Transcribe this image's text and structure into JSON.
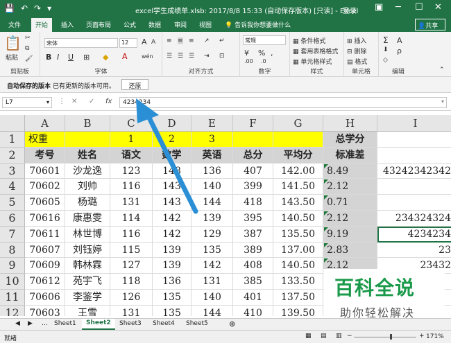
{
  "titlebar": {
    "title": "excel学生成绩单.xlsb: 2017/8/8 15:33 (自动保存版本) [只读] - Excel",
    "login": "登录",
    "save_icon": "save-icon",
    "undo_icon": "undo-icon",
    "redo_icon": "redo-icon"
  },
  "tabs": [
    "文件",
    "开始",
    "插入",
    "页面布局",
    "公式",
    "数据",
    "审阅",
    "视图"
  ],
  "active_tab": "开始",
  "tellme": "告诉我你想要做什么",
  "share": "共享",
  "ribbon": {
    "clipboard": {
      "paste": "粘贴",
      "label": "剪贴板"
    },
    "font": {
      "name": "宋体",
      "size": "12",
      "bold": "B",
      "italic": "I",
      "underline": "U",
      "grow": "A",
      "shrink": "A",
      "wen": "wén",
      "label": "字体"
    },
    "align": {
      "label": "对齐方式"
    },
    "number": {
      "format": "常规",
      "currency": "¥",
      "percent": "%",
      "comma": ",",
      "label": "数字"
    },
    "styles": {
      "cond": "条件格式",
      "table": "套用表格格式",
      "cell": "单元格样式",
      "label": "样式"
    },
    "cells": {
      "insert": "插入",
      "delete": "删除",
      "format": "格式",
      "label": "单元格"
    },
    "editing": {
      "sum": "Σ",
      "sort": "A",
      "find": "ρ",
      "label": "编辑"
    }
  },
  "msgbar": {
    "title": "自动保存的版本",
    "desc": "已有更新的版本可用。",
    "restore": "还原"
  },
  "formula": {
    "namebox": "L7",
    "cancel": "✕",
    "enter": "✓",
    "fx": "fx",
    "value": "4234234"
  },
  "grid": {
    "columns": [
      "A",
      "B",
      "C",
      "D",
      "E",
      "F",
      "G",
      "H",
      "I"
    ],
    "rows": [
      "1",
      "2",
      "3",
      "4",
      "5",
      "6",
      "7",
      "8",
      "9",
      "10",
      "11",
      "12",
      "13"
    ],
    "row1": {
      "a": "权重",
      "c": "1",
      "d": "2",
      "e": "3",
      "h": "总学分"
    },
    "headers": [
      "考号",
      "姓名",
      "语文",
      "数学",
      "英语",
      "总分",
      "平均分",
      "标准差"
    ],
    "data": [
      {
        "id": "70601",
        "name": "沙龙逸",
        "chinese": "123",
        "math": "148",
        "english": "136",
        "total": "407",
        "avg": "142.00",
        "std": "8.49",
        "extra": "43242342342"
      },
      {
        "id": "70602",
        "name": "刘帅",
        "chinese": "116",
        "math": "143",
        "english": "140",
        "total": "399",
        "avg": "141.50",
        "std": "2.12",
        "extra": ""
      },
      {
        "id": "70605",
        "name": "杨璐",
        "chinese": "131",
        "math": "143",
        "english": "144",
        "total": "418",
        "avg": "143.50",
        "std": "0.71",
        "extra": ""
      },
      {
        "id": "70616",
        "name": "康惠雯",
        "chinese": "114",
        "math": "142",
        "english": "139",
        "total": "395",
        "avg": "140.50",
        "std": "2.12",
        "extra": "234324324"
      },
      {
        "id": "70611",
        "name": "林世博",
        "chinese": "116",
        "math": "142",
        "english": "129",
        "total": "387",
        "avg": "135.50",
        "std": "9.19",
        "extra": "4234234"
      },
      {
        "id": "70607",
        "name": "刘钰婷",
        "chinese": "115",
        "math": "139",
        "english": "135",
        "total": "389",
        "avg": "137.00",
        "std": "2.83",
        "extra": "23"
      },
      {
        "id": "70609",
        "name": "韩林霖",
        "chinese": "127",
        "math": "139",
        "english": "142",
        "total": "408",
        "avg": "140.50",
        "std": "2.12",
        "extra": "23432"
      },
      {
        "id": "70612",
        "name": "苑宇飞",
        "chinese": "118",
        "math": "136",
        "english": "131",
        "total": "385",
        "avg": "133.50",
        "std": "",
        "extra": ""
      },
      {
        "id": "70606",
        "name": "李鉴学",
        "chinese": "126",
        "math": "135",
        "english": "140",
        "total": "401",
        "avg": "137.50",
        "std": "",
        "extra": ""
      },
      {
        "id": "70603",
        "name": "王雪",
        "chinese": "131",
        "math": "135",
        "english": "144",
        "total": "410",
        "avg": "139.50",
        "std": "",
        "extra": ""
      }
    ]
  },
  "sheets": [
    "Sheet1",
    "Sheet2",
    "Sheet3",
    "Sheet4",
    "Sheet5"
  ],
  "active_sheet": "Sheet2",
  "status": {
    "ready": "就绪",
    "zoom": "171%"
  },
  "watermark": {
    "line1": "百科全说",
    "line2": "助你轻松解决"
  },
  "colors": {
    "excel_green": "#217346",
    "highlight_yellow": "#ffff00",
    "header_grey": "#d4d4d4",
    "arrow_blue": "#2b8fd6",
    "watermark_green": "#1a9a4a"
  }
}
